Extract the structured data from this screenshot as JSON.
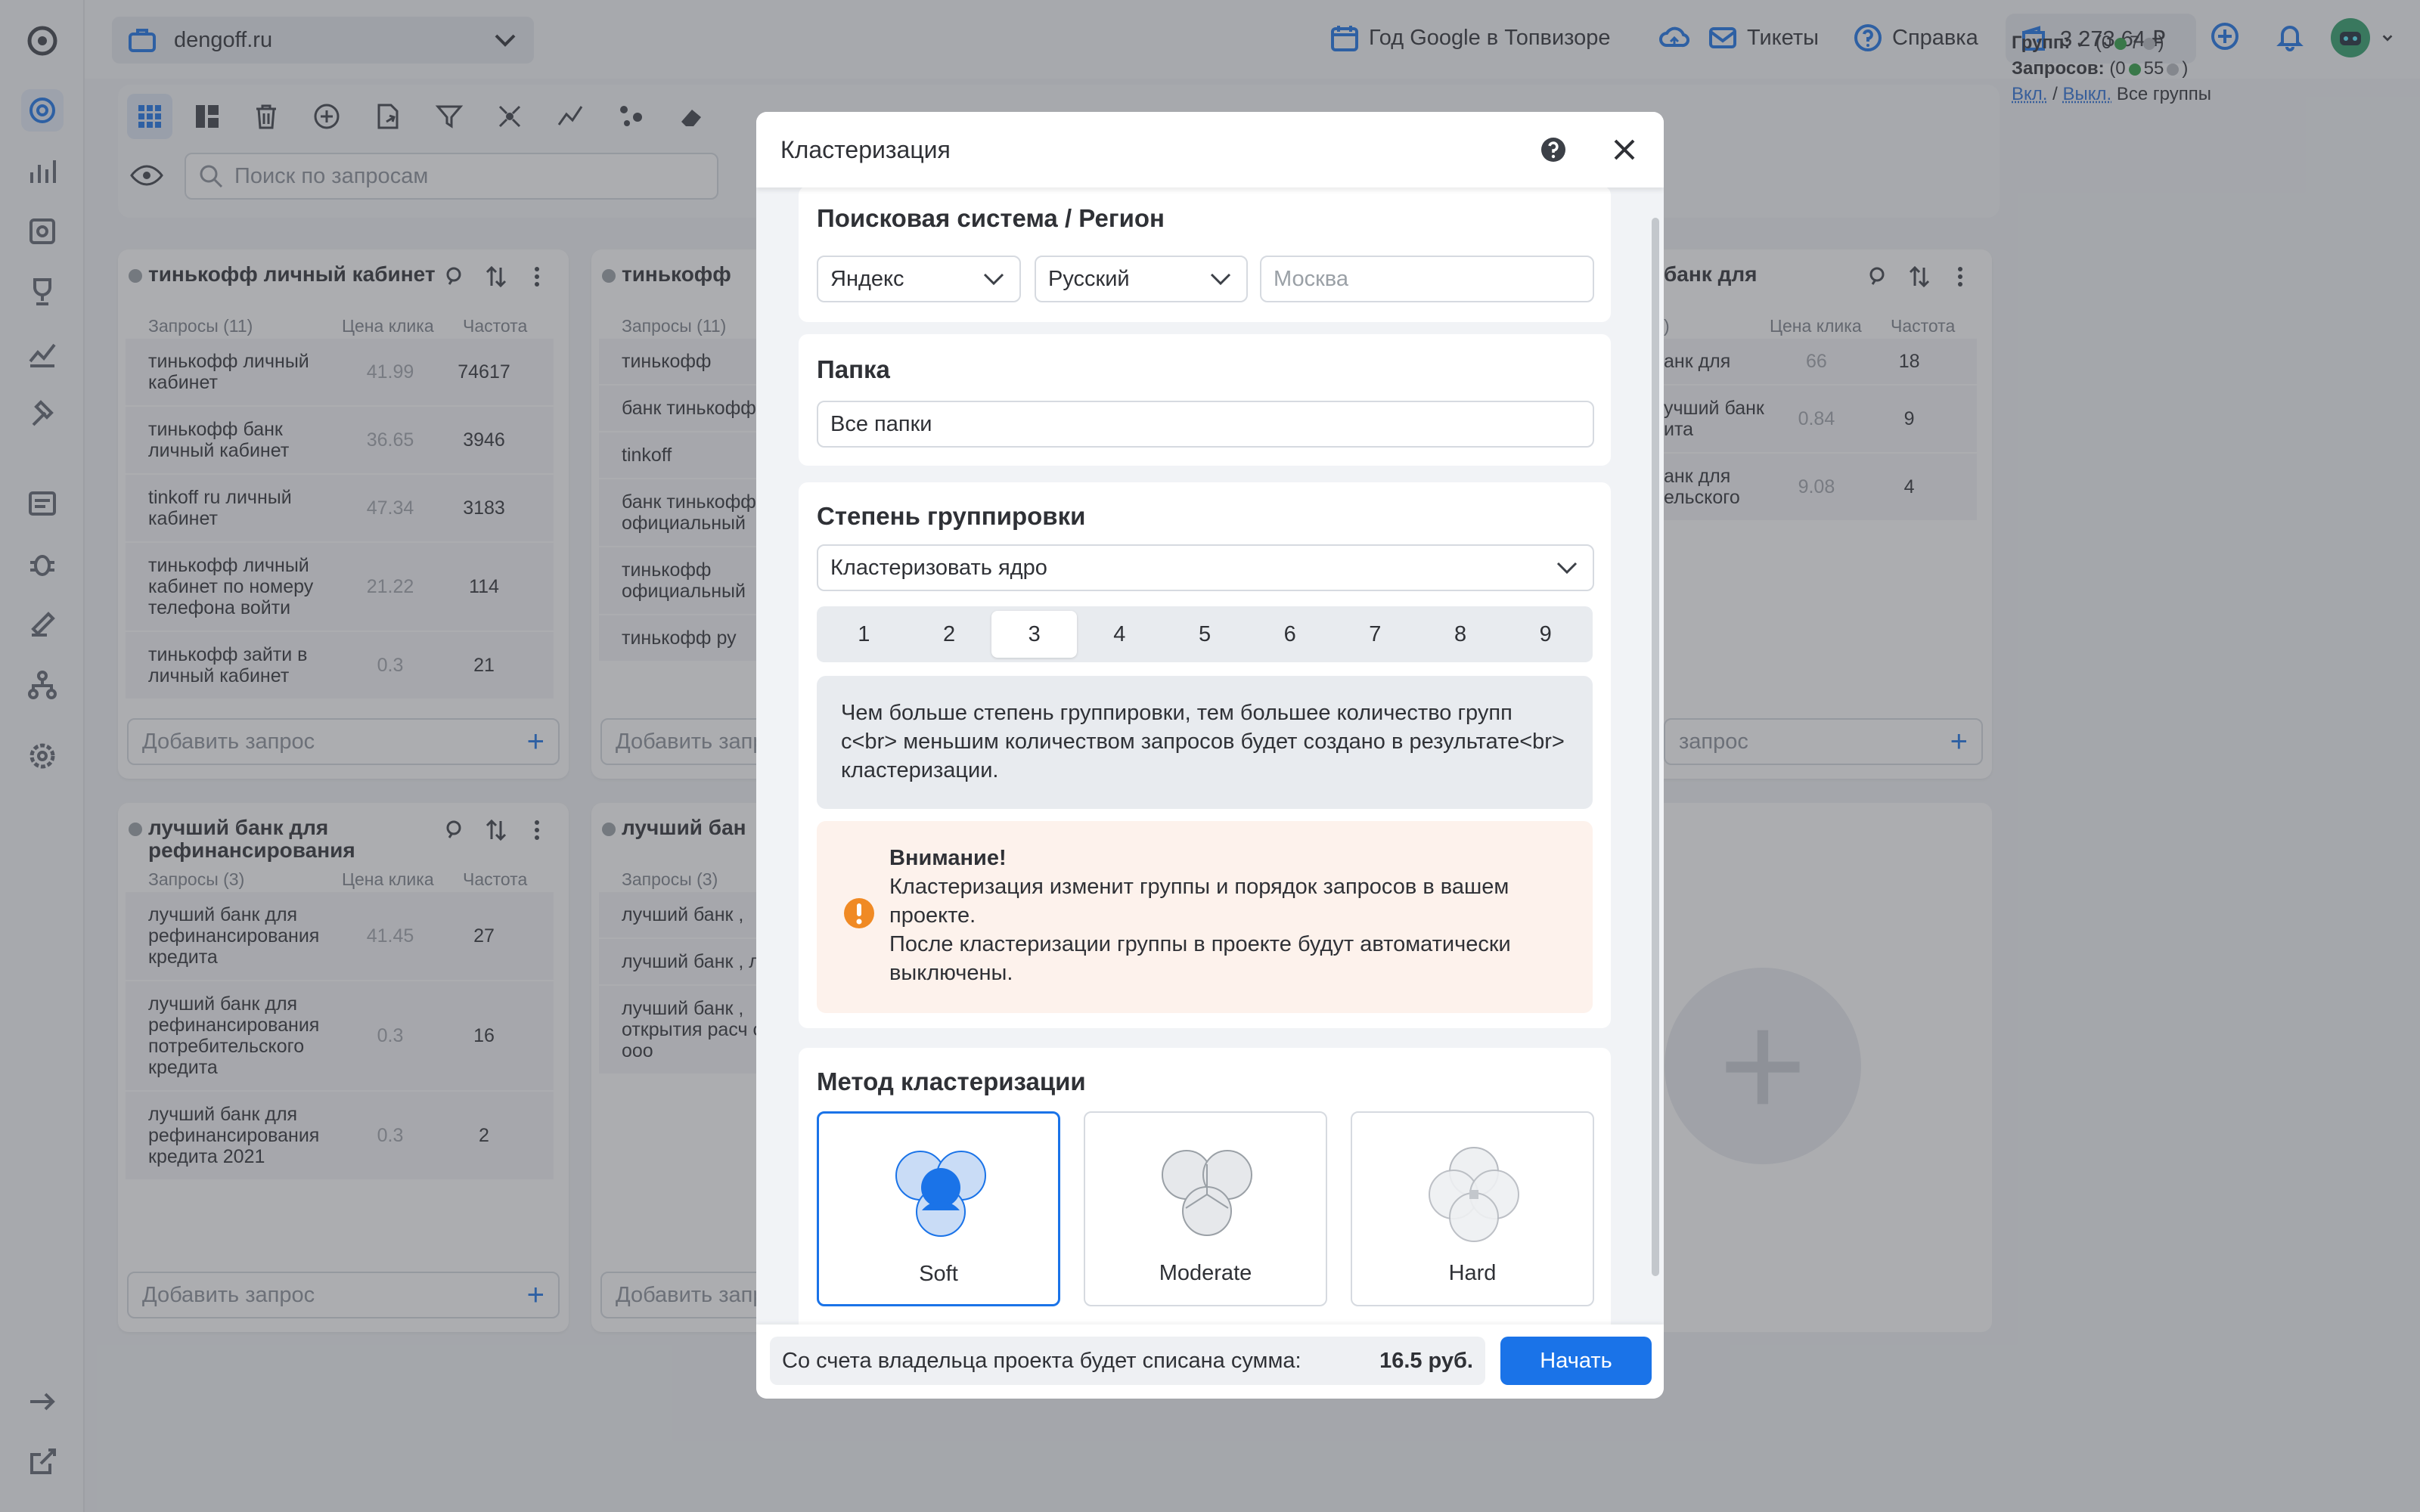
{
  "colors": {
    "accent": "#1a73e8",
    "warning": "#f08a24",
    "group_dot": "#9aa0a6",
    "green": "#2e9e44"
  },
  "topbar": {
    "project": "dengoff.ru",
    "links": [
      {
        "label": "Год Google в Топвизоре",
        "icon": "calendar-icon"
      },
      {
        "label": "",
        "icon": "cloud-upload-icon"
      },
      {
        "label": "Тикеты",
        "icon": "mail-icon"
      },
      {
        "label": "Справка",
        "icon": "help-icon"
      }
    ],
    "balance": "3 273.64 ₽"
  },
  "toolbar": {
    "search_placeholder": "Поиск по запросам"
  },
  "stats": {
    "groups_label": "Групп:",
    "groups_green": "7",
    "queries_label": "Запросов:",
    "queries_green": "55",
    "on": "Вкл.",
    "off": "Выкл.",
    "all": "Все группы",
    "open": "(0",
    "close": ")"
  },
  "table_headers": {
    "price": "Цена клика",
    "freq": "Частота"
  },
  "groups": [
    {
      "title": "тинькофф личный кабинет",
      "count": "Запросы (11)",
      "add": "Добавить запрос",
      "rows": [
        {
          "q": "тинькофф личный кабинет",
          "p": "41.99",
          "f": "74617"
        },
        {
          "q": "тинькофф банк личный кабинет",
          "p": "36.65",
          "f": "3946"
        },
        {
          "q": "tinkoff ru личный кабинет",
          "p": "47.34",
          "f": "3183"
        },
        {
          "q": "тинькофф личный кабинет по номеру телефона войти",
          "p": "21.22",
          "f": "114"
        },
        {
          "q": "тинькофф зайти в личный кабинет",
          "p": "0.3",
          "f": "21"
        }
      ]
    },
    {
      "title": "тинькофф",
      "count": "Запросы (11)",
      "add": "Добавить запрос",
      "rows": [
        {
          "q": "тинькофф",
          "p": "",
          "f": ""
        },
        {
          "q": "банк тинькофф",
          "p": "",
          "f": ""
        },
        {
          "q": "tinkoff",
          "p": "",
          "f": ""
        },
        {
          "q": "банк тинькофф официальный",
          "p": "",
          "f": ""
        },
        {
          "q": "тинькофф официальный",
          "p": "",
          "f": ""
        },
        {
          "q": "тинькофф ру",
          "p": "",
          "f": ""
        }
      ]
    },
    {
      "title": "банк для",
      "count": ")",
      "add": "запрос",
      "rows": [
        {
          "q": "анк для",
          "p": "66",
          "f": "18"
        },
        {
          "q": "учший банк ита",
          "p": "0.84",
          "f": "9"
        },
        {
          "q": "анк для ельского",
          "p": "9.08",
          "f": "4"
        }
      ]
    },
    {
      "title": "лучший банк для рефинансирования",
      "count": "Запросы (3)",
      "add": "Добавить запрос",
      "rows": [
        {
          "q": "лучший банк для рефинансирования кредита",
          "p": "41.45",
          "f": "27"
        },
        {
          "q": "лучший банк для рефинансирования потребительского кредита",
          "p": "0.3",
          "f": "16"
        },
        {
          "q": "лучший банк для рефинансирования кредита 2021",
          "p": "0.3",
          "f": "2"
        }
      ]
    },
    {
      "title": "лучший бан",
      "count": "Запросы (3)",
      "add": "Добавить запр",
      "rows": [
        {
          "q": "лучший банк ,",
          "p": "",
          "f": ""
        },
        {
          "q": "лучший банк , лиц",
          "p": "",
          "f": ""
        },
        {
          "q": "лучший банк , открытия расч счета ооо",
          "p": "",
          "f": ""
        }
      ]
    }
  ],
  "modal": {
    "title": "Кластеризация",
    "search_section": {
      "title": "Поисковая система / Регион",
      "engine": "Яндекс",
      "language": "Русский",
      "region_placeholder": "Москва"
    },
    "folder_section": {
      "title": "Папка",
      "value": "Все папки"
    },
    "grouping_section": {
      "title": "Степень группировки",
      "mode": "Кластеризовать ядро",
      "steps": [
        "1",
        "2",
        "3",
        "4",
        "5",
        "6",
        "7",
        "8",
        "9"
      ],
      "selected_step": "3",
      "hint": "Чем больше степень группировки, тем большее количество групп с<br> меньшим количеством запросов будет создано в результате<br> кластеризации.",
      "warning_title": "Внимание!",
      "warning_line1": "Кластеризация изменит группы и порядок запросов в вашем проекте.",
      "warning_line2": "После кластеризации группы в проекте будут автоматически выключены."
    },
    "method_section": {
      "title": "Метод кластеризации",
      "options": [
        "Soft",
        "Moderate",
        "Hard"
      ],
      "selected": "Soft"
    },
    "footer": {
      "charge_text": "Со счета владельца проекта будет списана сумма:",
      "amount": "16.5 руб.",
      "start": "Начать"
    }
  }
}
